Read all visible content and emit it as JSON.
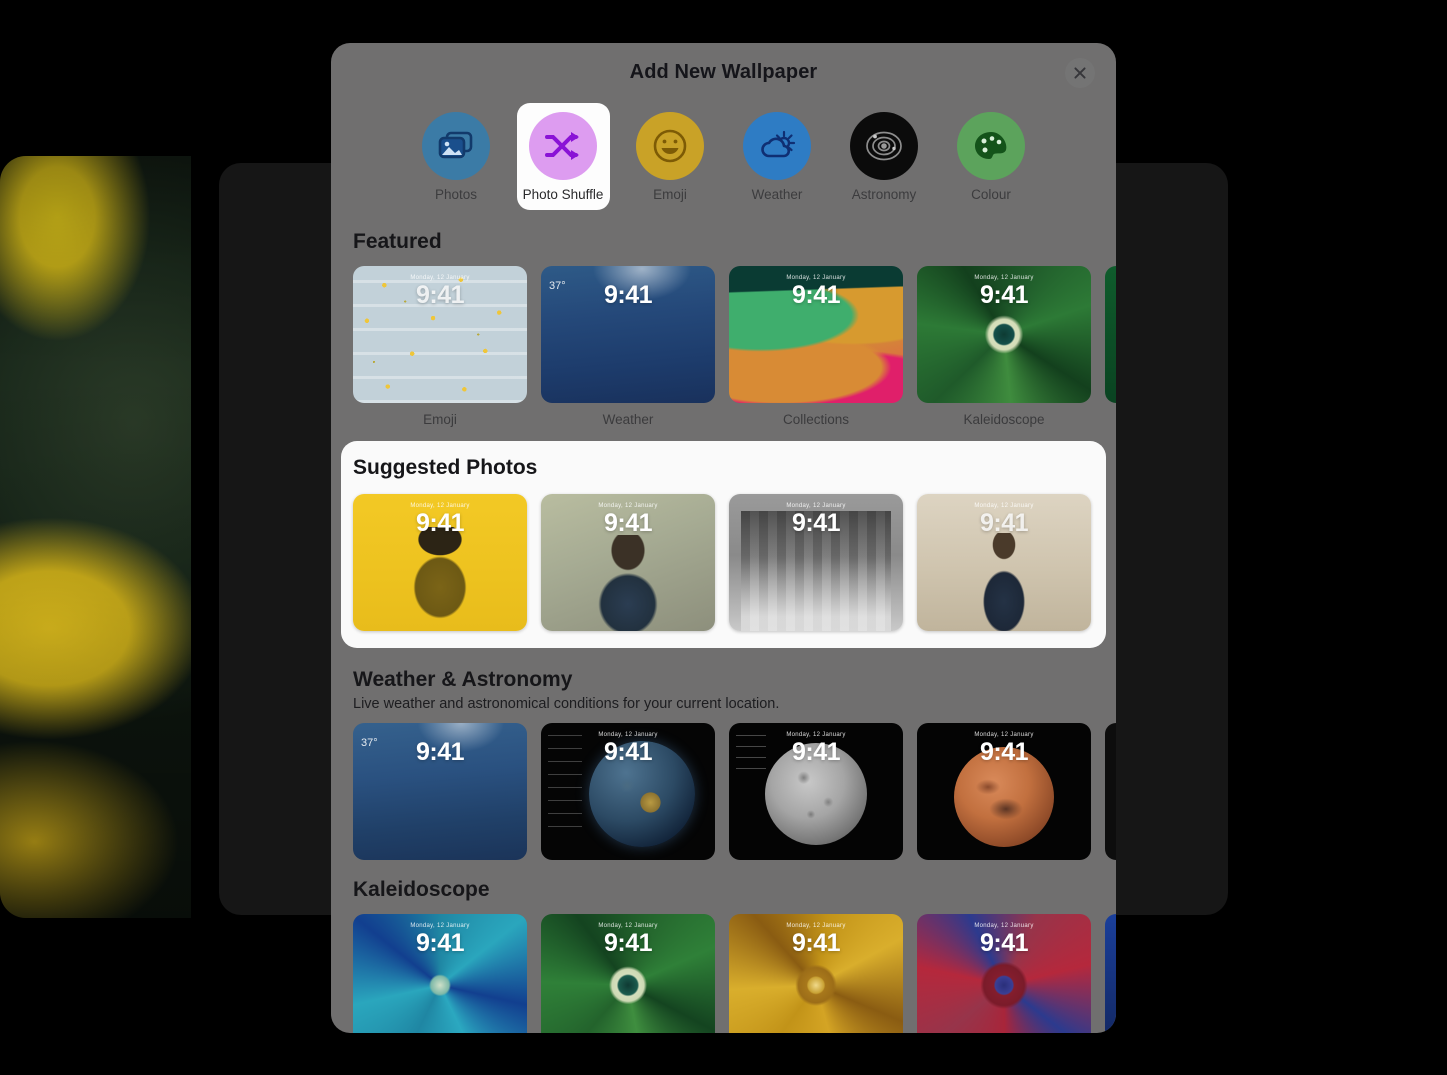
{
  "modal": {
    "title": "Add New Wallpaper",
    "close_icon": "close-icon",
    "close_label": "Close"
  },
  "categories": [
    {
      "label": "Photos",
      "icon": "photos-icon",
      "color": "#3b7ba6",
      "selected": false
    },
    {
      "label": "Photo Shuffle",
      "icon": "shuffle-icon",
      "color": "#dd9cf0",
      "selected": true
    },
    {
      "label": "Emoji",
      "icon": "emoji-smile-icon",
      "color": "#c9a227",
      "selected": false
    },
    {
      "label": "Weather",
      "icon": "weather-cloud-sun-icon",
      "color": "#2e7cc4",
      "selected": false
    },
    {
      "label": "Astronomy",
      "icon": "astronomy-orbit-icon",
      "color": "#0b0b0b",
      "selected": false
    },
    {
      "label": "Colour",
      "icon": "colour-palette-icon",
      "color": "#5ca35c",
      "selected": false
    }
  ],
  "sections": {
    "featured": {
      "title": "Featured",
      "tiles": [
        {
          "caption": "Emoji",
          "time": "9:41",
          "date": "Monday, 12 January",
          "art": "emoji"
        },
        {
          "caption": "Weather",
          "time": "9:41",
          "date": "",
          "art": "weather",
          "weather_temp": "37°"
        },
        {
          "caption": "Collections",
          "time": "9:41",
          "date": "Monday, 12 January",
          "art": "collections"
        },
        {
          "caption": "Kaleidoscope",
          "time": "9:41",
          "date": "Monday, 12 January",
          "art": "kaleido-green"
        },
        {
          "caption": "",
          "time": "",
          "date": "",
          "art": "green-clip",
          "partial": true
        }
      ]
    },
    "suggested_photos": {
      "title": "Suggested Photos",
      "highlighted": true,
      "tiles": [
        {
          "time": "9:41",
          "date": "Monday, 12 January",
          "art": "photo-yellow-portrait"
        },
        {
          "time": "9:41",
          "date": "Monday, 12 January",
          "art": "photo-olive-portrait"
        },
        {
          "time": "9:41",
          "date": "Monday, 12 January",
          "art": "photo-bw-group"
        },
        {
          "time": "9:41",
          "date": "Monday, 12 January",
          "art": "photo-beige-portrait"
        }
      ]
    },
    "weather_astronomy": {
      "title": "Weather & Astronomy",
      "subtitle": "Live weather and astronomical conditions for your current location.",
      "tiles": [
        {
          "time": "9:41",
          "date": "",
          "art": "wx-live",
          "weather_temp": "37°"
        },
        {
          "time": "9:41",
          "date": "Monday, 12 January",
          "art": "earth"
        },
        {
          "time": "9:41",
          "date": "Monday, 12 January",
          "art": "moon"
        },
        {
          "time": "9:41",
          "date": "Monday, 12 January",
          "art": "mars"
        },
        {
          "time": "",
          "date": "",
          "art": "grey-clip",
          "partial": true
        }
      ]
    },
    "kaleidoscope": {
      "title": "Kaleidoscope",
      "tiles": [
        {
          "time": "9:41",
          "date": "Monday, 12 January",
          "art": "k-teal"
        },
        {
          "time": "9:41",
          "date": "Monday, 12 January",
          "art": "k-green2"
        },
        {
          "time": "9:41",
          "date": "Monday, 12 January",
          "art": "k-gold"
        },
        {
          "time": "9:41",
          "date": "Monday, 12 January",
          "art": "k-red"
        },
        {
          "time": "",
          "date": "",
          "art": "blue-clip",
          "partial": true
        }
      ]
    }
  },
  "colors": {
    "modal_bg": "#706f6f",
    "highlight_card_bg": "#fafafa",
    "selected_chip_bg": "#fdfdfd",
    "backdrop": "#000000",
    "back_panel": "#161616"
  }
}
